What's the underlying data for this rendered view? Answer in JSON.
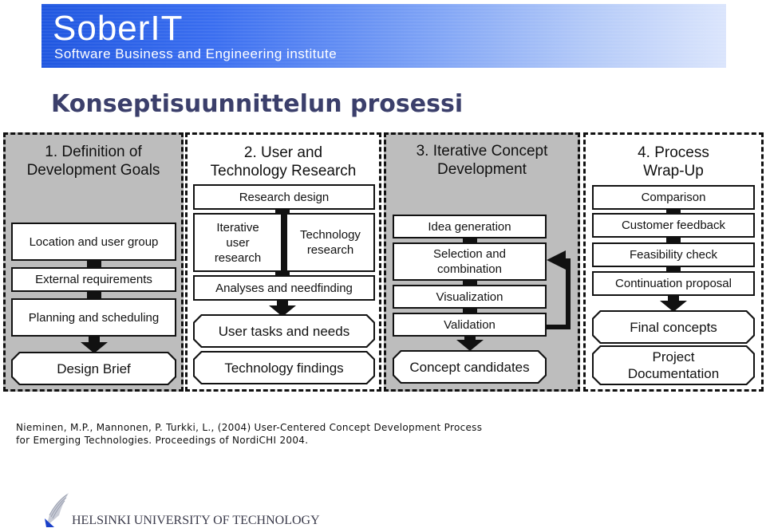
{
  "header": {
    "brand": "SoberIT",
    "subtitle": "Software Business and Engineering institute",
    "banner_colors": [
      "#1f56e0",
      "#dbe5fc"
    ]
  },
  "slide_title": "Konseptisuunnittelun prosessi",
  "diagram": {
    "columns": [
      {
        "title_line1": "1. Definition of",
        "title_line2": "Development Goals",
        "steps": [
          "Location and user group",
          "External requirements",
          "Planning and scheduling"
        ],
        "output": "Design Brief"
      },
      {
        "title_line1": "2. User and",
        "title_line2": "Technology Research",
        "steps": [
          "Research design",
          "Iterative user research",
          "Technology research",
          "Analyses and needfinding"
        ],
        "step_lines": {
          "iterative": [
            "Iterative",
            "user",
            "research"
          ],
          "technology": [
            "Technology",
            "research"
          ]
        },
        "outputs": [
          "User tasks and needs",
          "Technology findings"
        ]
      },
      {
        "title_line1": "3. Iterative Concept",
        "title_line2": "Development",
        "steps": [
          "Idea generation",
          "Selection and combination",
          "Visualization",
          "Validation"
        ],
        "step_lines": {
          "selection": [
            "Selection and",
            "combination"
          ]
        },
        "feedback_loop": "Validation → Selection and combination",
        "output": "Concept candidates"
      },
      {
        "title_line1": "4. Process",
        "title_line2": "Wrap-Up",
        "steps": [
          "Comparison",
          "Customer feedback",
          "Feasibility check",
          "Continuation proposal"
        ],
        "outputs": [
          "Final concepts",
          "Project Documentation"
        ],
        "output_lines": {
          "project": [
            "Project",
            "Documentation"
          ]
        }
      }
    ],
    "colors": {
      "gray_phase": "#bdbdbd",
      "white_phase": "#ffffff",
      "ink": "#111111"
    }
  },
  "citation": {
    "line1": "Nieminen, M.P., Mannonen, P. Turkki, L., (2004) User-Centered Concept Development Process",
    "line2": "for Emerging Technologies. Proceedings of NordiCHI 2004."
  },
  "footer": {
    "institution": "HELSINKI UNIVERSITY OF TECHNOLOGY",
    "logo_icon": "hut-wing-logo-icon"
  }
}
